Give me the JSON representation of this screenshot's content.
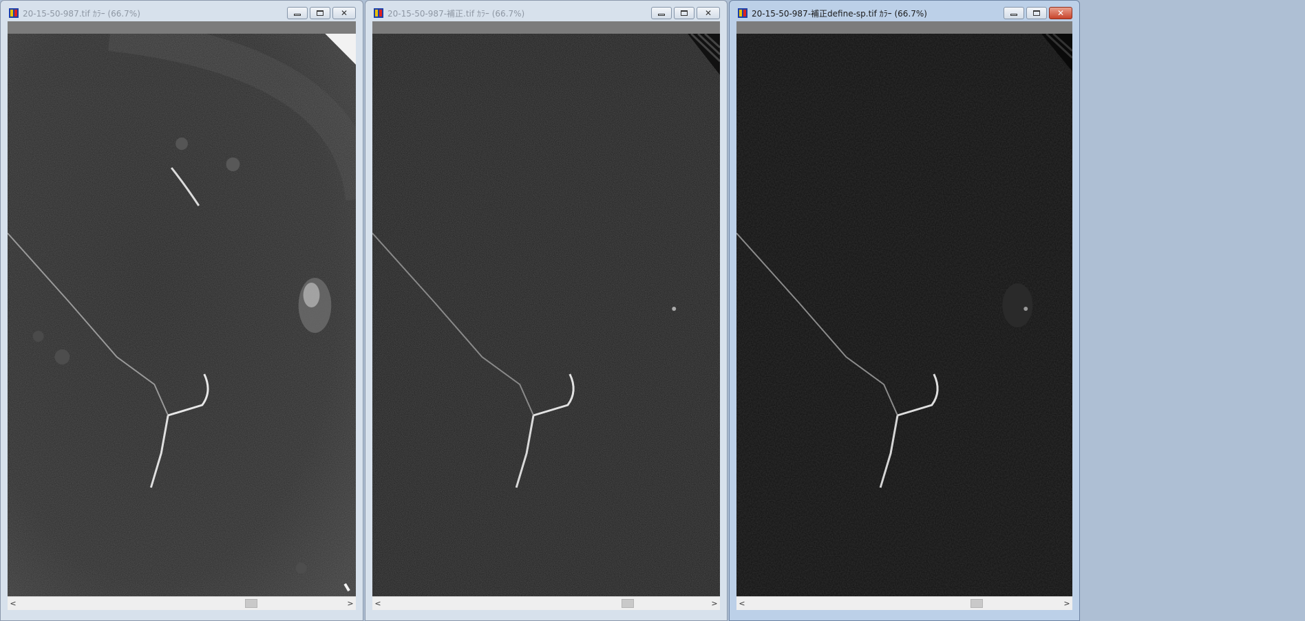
{
  "windows": [
    {
      "id": "original",
      "title": "20-15-50-987.tif ｶﾗｰ (66.7%)",
      "active": false,
      "buttons": {
        "minimize": "minimize",
        "maximize": "maximize",
        "close": "close"
      },
      "scrollbar": {
        "left_arrow": "<",
        "right_arrow": ">",
        "thumb_position": 0.7
      }
    },
    {
      "id": "corrected",
      "title": "20-15-50-987-補正.tif ｶﾗｰ (66.7%)",
      "active": false,
      "buttons": {
        "minimize": "minimize",
        "maximize": "maximize",
        "close": "close"
      },
      "scrollbar": {
        "left_arrow": "<",
        "right_arrow": ">",
        "thumb_position": 0.73
      }
    },
    {
      "id": "corrected-define-sp",
      "title": "20-15-50-987-補正define-sp.tif ｶﾗｰ (66.7%)",
      "active": true,
      "buttons": {
        "minimize": "minimize",
        "maximize": "maximize",
        "close": "close"
      },
      "scrollbar": {
        "left_arrow": "<",
        "right_arrow": ">",
        "thumb_position": 0.72
      }
    }
  ],
  "icons": {
    "app": "imagej-app-icon",
    "minimize": "minimize-icon",
    "maximize": "maximize-icon",
    "close": "close-icon"
  },
  "colors": {
    "canvas_gray": "#7c7c7c",
    "image_bg_original": "#2a2a2a",
    "image_bg_corrected": "#1e1e1e",
    "image_bg_define": "#131313",
    "active_close": "#c8442b"
  }
}
